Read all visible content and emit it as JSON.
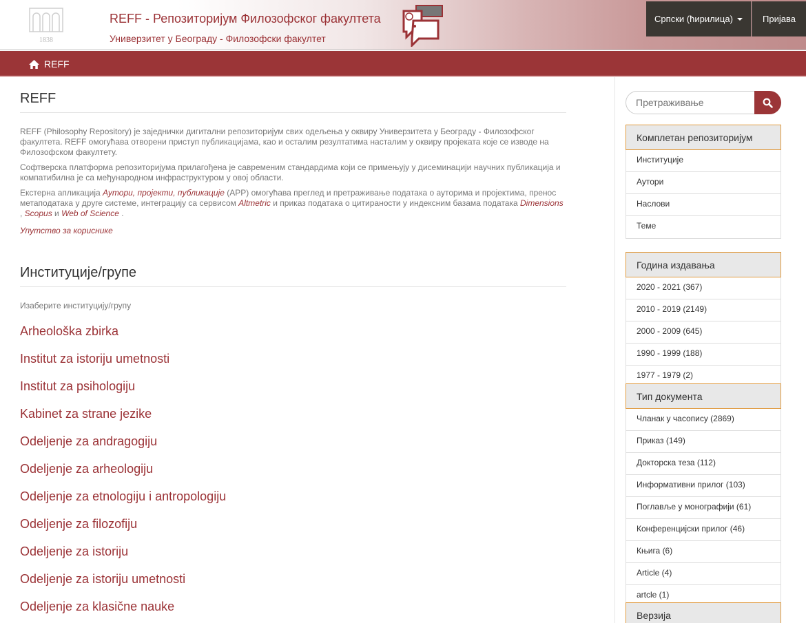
{
  "header": {
    "logo_year": "1838",
    "title": "REFF - Репозиторијум Филозофског факултета",
    "subtitle": "Универзитет у Београду - Филозофски факултет",
    "language_label": "Српски (ћирилица)",
    "login_label": "Пријава",
    "colors": {
      "brand": "#9b3236",
      "dark_button": "#3a3732"
    }
  },
  "breadcrumb": {
    "home_label": "REFF"
  },
  "main": {
    "title": "REFF",
    "intro": {
      "p1": "REFF (Philosophy Repository) је заједнички дигитални репозиторијум свих одељења у оквиру Универзитета у Београду - Филозофског факултета. REFF омогућава отворени приступ публикацијама, као и осталим резултатима насталим у оквиру пројеката које се изводе на Филозофском факултету.",
      "p2": "Софтверска платформа репозиторијума прилагођена је савременим стандардима који се примењују у дисеминацији научних публикација и компатибилна је са међународном инфраструктуром у овој области.",
      "p3_a": "Екстерна апликација ",
      "p3_link1": "Аутори, пројекти, публикације",
      "p3_b": " (APP) омогућава преглед и претраживање података о ауторима и пројектима, пренос метаподатака у друге системе, интеграцију са сервисом ",
      "p3_link2": "Altmetric",
      "p3_c": " и приказ података о цитираности у индексним базама података ",
      "p3_link3": "Dimensions",
      "p3_d": " , ",
      "p3_link4": "Scopus",
      "p3_e": " и ",
      "p3_link5": "Web of Science",
      "p3_f": " .",
      "guide_link": "Упутство за кориснике"
    },
    "section_title": "Институције/групе",
    "choose_label": "Изаберите институцију/групу",
    "communities": [
      "Arheološka zbirka",
      "Institut za istoriju umetnosti",
      "Institut za psihologiju",
      "Kabinet za strane jezike",
      "Odeljenje za andragogiju",
      "Odeljenje za arheologiju",
      "Odeljenje za etnologiju i antropologiju",
      "Odeljenje za filozofiju",
      "Odeljenje za istoriju",
      "Odeljenje za istoriju umetnosti",
      "Odeljenje za klasične nauke"
    ]
  },
  "sidebar": {
    "search_placeholder": "Претраживање",
    "repository": {
      "title": "Комплетан репозиторијум",
      "items": [
        "Институције",
        "Аутори",
        "Наслови",
        "Теме"
      ]
    },
    "year": {
      "title": "Година издавања",
      "items": [
        "2020 - 2021 (367)",
        "2010 - 2019 (2149)",
        "2000 - 2009 (645)",
        "1990 - 1999 (188)",
        "1977 - 1979 (2)"
      ]
    },
    "doctype": {
      "title": "Тип документа",
      "items": [
        "Чланак у часопису (2869)",
        "Приказ (149)",
        "Докторска теза (112)",
        "Информативни прилог (103)",
        "Поглавље у монографији (61)",
        "Конференцијски прилог (46)",
        "Књига (6)",
        "Article (4)",
        "artcle (1)"
      ]
    },
    "version": {
      "title": "Верзија"
    }
  }
}
